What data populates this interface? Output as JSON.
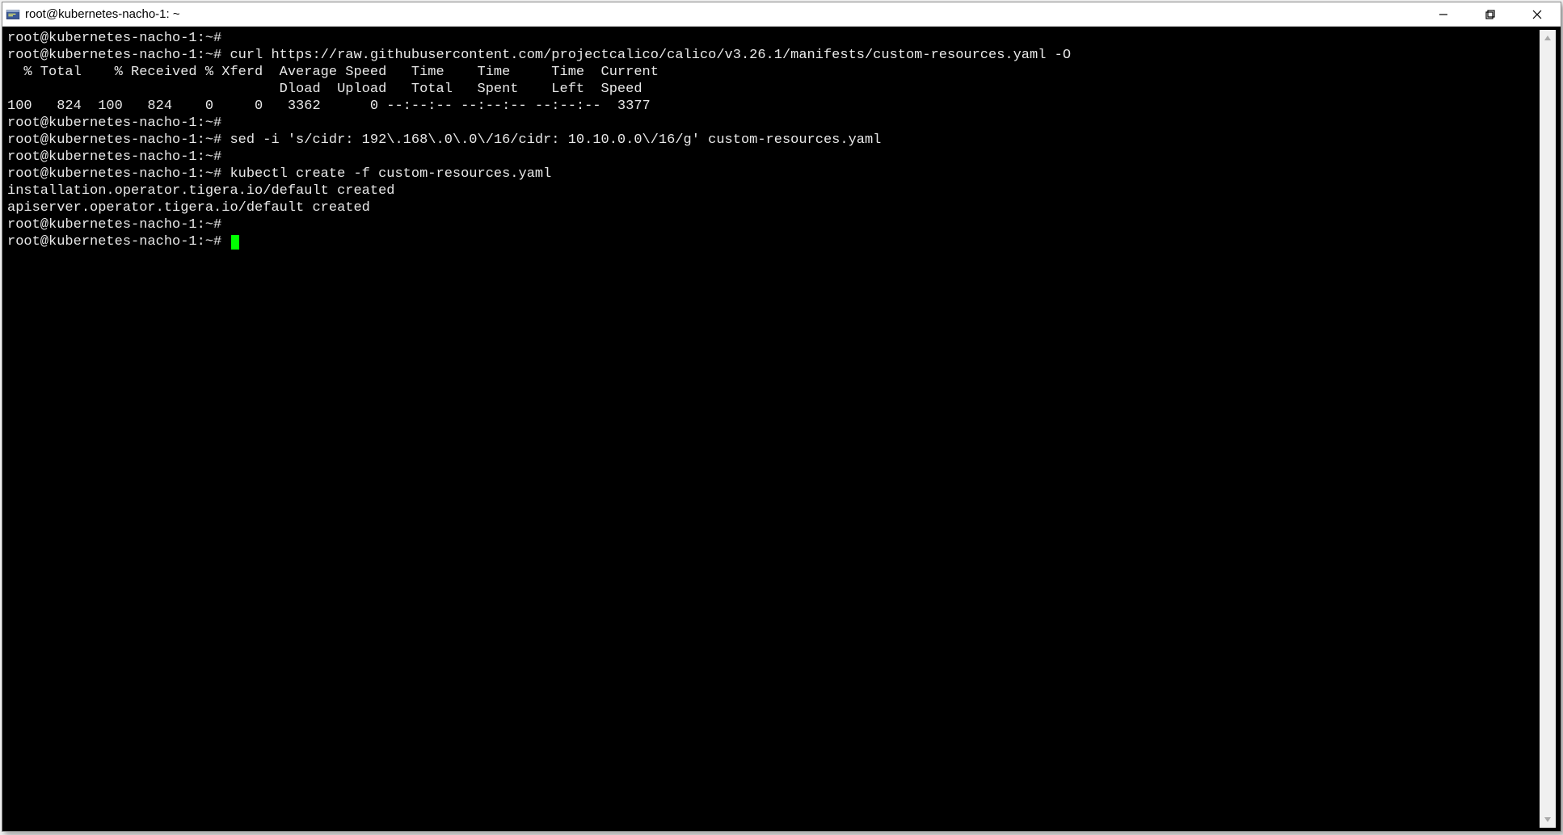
{
  "window": {
    "title": "root@kubernetes-nacho-1: ~"
  },
  "terminal": {
    "lines": [
      "root@kubernetes-nacho-1:~#",
      "root@kubernetes-nacho-1:~# curl https://raw.githubusercontent.com/projectcalico/calico/v3.26.1/manifests/custom-resources.yaml -O",
      "  % Total    % Received % Xferd  Average Speed   Time    Time     Time  Current",
      "                                 Dload  Upload   Total   Spent    Left  Speed",
      "100   824  100   824    0     0   3362      0 --:--:-- --:--:-- --:--:--  3377",
      "root@kubernetes-nacho-1:~#",
      "root@kubernetes-nacho-1:~# sed -i 's/cidr: 192\\.168\\.0\\.0\\/16/cidr: 10.10.0.0\\/16/g' custom-resources.yaml",
      "root@kubernetes-nacho-1:~#",
      "root@kubernetes-nacho-1:~# kubectl create -f custom-resources.yaml",
      "installation.operator.tigera.io/default created",
      "apiserver.operator.tigera.io/default created",
      "root@kubernetes-nacho-1:~#"
    ],
    "prompt": "root@kubernetes-nacho-1:~# "
  }
}
